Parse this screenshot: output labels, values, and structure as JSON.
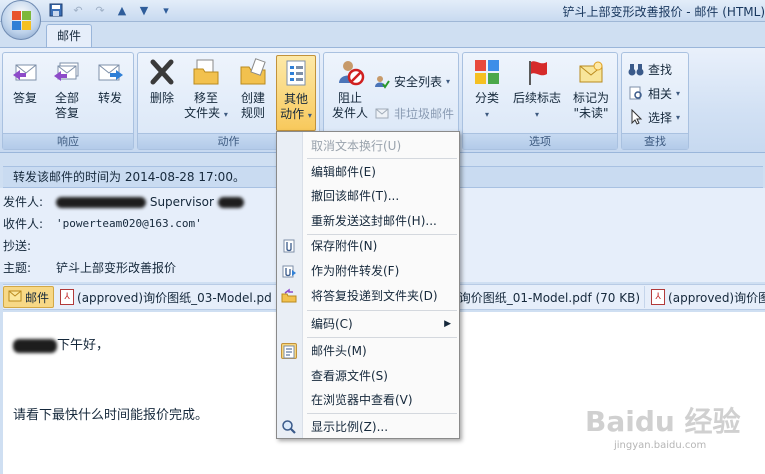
{
  "window": {
    "title": "铲斗上部变形改善报价 - 邮件 (HTML)"
  },
  "tabs": [
    {
      "label": "邮件"
    }
  ],
  "ribbon": {
    "groups": {
      "respond": {
        "label": "响应",
        "buttons": {
          "reply": "答复",
          "reply_all_1": "全部",
          "reply_all_2": "答复",
          "forward": "转发"
        }
      },
      "actions": {
        "label": "动作",
        "buttons": {
          "delete": "删除",
          "move_1": "移至",
          "move_2": "文件夹",
          "rules_1": "创建",
          "rules_2": "规则",
          "other_1": "其他",
          "other_2": "动作"
        }
      },
      "junk": {
        "buttons": {
          "block_1": "阻止",
          "block_2": "发件人",
          "safe_lists": "安全列表",
          "not_junk": "非垃圾邮件"
        }
      },
      "options": {
        "label": "选项",
        "buttons": {
          "categorize": "分类",
          "followup": "后续标志",
          "mark_1": "标记为",
          "mark_2": "\"未读\""
        }
      },
      "find": {
        "label": "查找",
        "buttons": {
          "find": "查找",
          "related": "相关",
          "select": "选择"
        }
      }
    }
  },
  "message": {
    "info": "转发该邮件的时间为 2014-08-28 17:00。",
    "from_label": "发件人:",
    "from_title": "Supervisor",
    "to_label": "收件人:",
    "to_value": "'powerteam020@163.com'",
    "cc_label": "抄送:",
    "subject_label": "主题:",
    "subject_value": "铲斗上部变形改善报价"
  },
  "attachments": [
    {
      "name": "邮件"
    },
    {
      "name": "(approved)询价图纸_03-Model.pd"
    },
    {
      "name": "询价图纸_01-Model.pdf (70 KB)"
    },
    {
      "name": "(approved)询价图纸_"
    }
  ],
  "body": {
    "line1": "下午好，",
    "line2": "请看下最快什么时间能报价完成。"
  },
  "menu": {
    "items": [
      {
        "label": "取消文本换行(U)",
        "disabled": true
      },
      {
        "label": "编辑邮件(E)"
      },
      {
        "label": "撤回该邮件(T)..."
      },
      {
        "label": "重新发送这封邮件(H)..."
      },
      {
        "label": "保存附件(N)"
      },
      {
        "label": "作为附件转发(F)"
      },
      {
        "label": "将答复投递到文件夹(D)"
      },
      {
        "label": "编码(C)"
      },
      {
        "label": "邮件头(M)"
      },
      {
        "label": "查看源文件(S)"
      },
      {
        "label": "在浏览器中查看(V)"
      },
      {
        "label": "显示比例(Z)..."
      }
    ]
  },
  "watermark": {
    "text": "Baidu 经验",
    "url": "jingyan.baidu.com"
  },
  "colors": {
    "ribbon_bg": "#d2e1f4",
    "active_button": "#f8c95c",
    "infobar": "#c9dbf1"
  }
}
